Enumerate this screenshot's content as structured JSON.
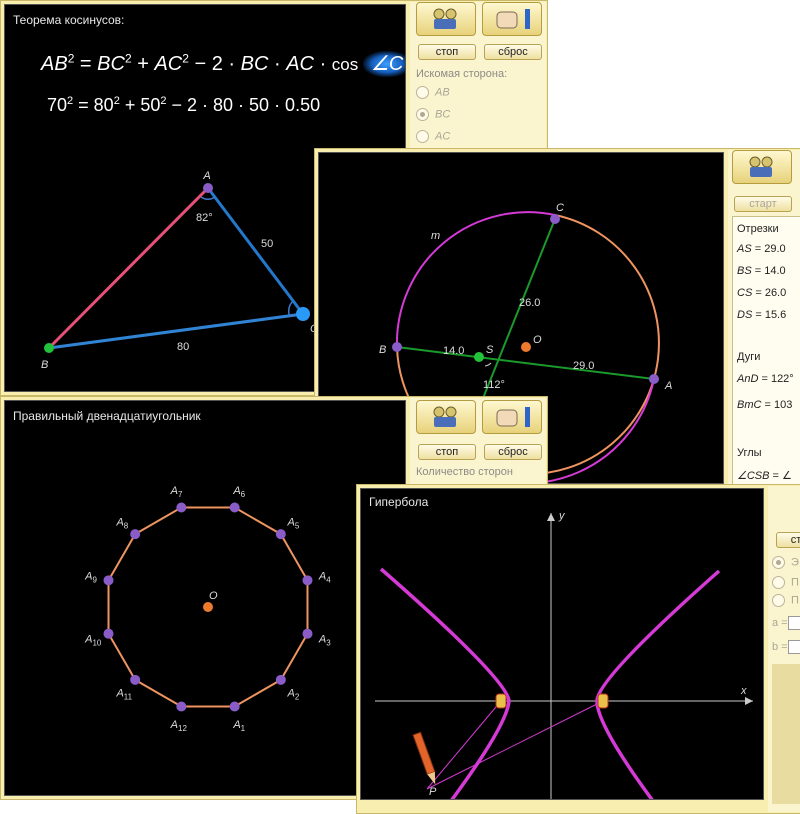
{
  "cosine": {
    "title": "Теорема косинусов:",
    "formula": {
      "ab": "AB",
      "sq": "2",
      "eq": " = ",
      "bc": "BC",
      "plus": " + ",
      "ac": "AC",
      "minus": " − 2 · ",
      "bc2": "BC",
      "dot": " · ",
      "ac2": "AC",
      "dot2": " · ",
      "cos": "cos ",
      "angle": "∠C"
    },
    "numeric": {
      "a": "70",
      "b": "80",
      "c": "50",
      "mul": "2 · 80  ·  50  ·  0.50"
    },
    "buttons": {
      "stop": "стоп",
      "reset": "сброс"
    },
    "group_label": "Искомая сторона:",
    "radios": [
      "AB",
      "BC",
      "AC"
    ],
    "selected": "BC",
    "points": {
      "A": "A",
      "B": "B",
      "C": "C"
    },
    "labels": {
      "angle": "82°",
      "side_ac": "50",
      "side_bc": "80"
    }
  },
  "circle": {
    "buttons": {
      "start": "старт"
    },
    "segments_title": "Отрезки",
    "segments": [
      {
        "name": "AS",
        "value": "= 29.0"
      },
      {
        "name": "BS",
        "value": "= 14.0"
      },
      {
        "name": "CS",
        "value": "= 26.0"
      },
      {
        "name": "DS",
        "value": "= 15.6"
      }
    ],
    "arcs_title": "Дуги",
    "arcs": [
      {
        "name": "AnD",
        "value": "= 122°"
      },
      {
        "name": "BmC",
        "value": "= 103"
      }
    ],
    "angles_title": "Углы",
    "angles": [
      {
        "name": "∠CSB",
        "value": "= ∠"
      }
    ],
    "points": {
      "A": "A",
      "B": "B",
      "C": "C",
      "S": "S",
      "O": "O",
      "m": "m"
    },
    "labels": {
      "bs": "14.0",
      "cs": "26.0",
      "as": "29.0",
      "angle": "112°"
    }
  },
  "dodecagon": {
    "title": "Правильный двенадцатиугольник",
    "buttons": {
      "stop": "стоп",
      "reset": "сброс"
    },
    "sides_label": "Количество сторон",
    "center": "O",
    "vertices": [
      "A",
      "A",
      "A",
      "A",
      "A",
      "A",
      "A",
      "A",
      "A",
      "A",
      "A",
      "A"
    ],
    "subscripts": [
      "1",
      "2",
      "3",
      "4",
      "5",
      "6",
      "7",
      "8",
      "9",
      "10",
      "11",
      "12"
    ]
  },
  "hyperbola": {
    "title": "Гипербола",
    "buttons": {
      "start": "ст"
    },
    "radios": [
      "Э",
      "П",
      "П"
    ],
    "fields": [
      "a =",
      "b ="
    ],
    "axes": {
      "x": "x",
      "y": "y"
    },
    "point": "P"
  },
  "colors": {
    "panel": "#f7eeb0",
    "canvas": "#000000",
    "pink": "#e8507a",
    "blue": "#2a8df0",
    "magenta": "#d63ad6",
    "orange": "#ee9460",
    "green": "#1a9a2a"
  }
}
